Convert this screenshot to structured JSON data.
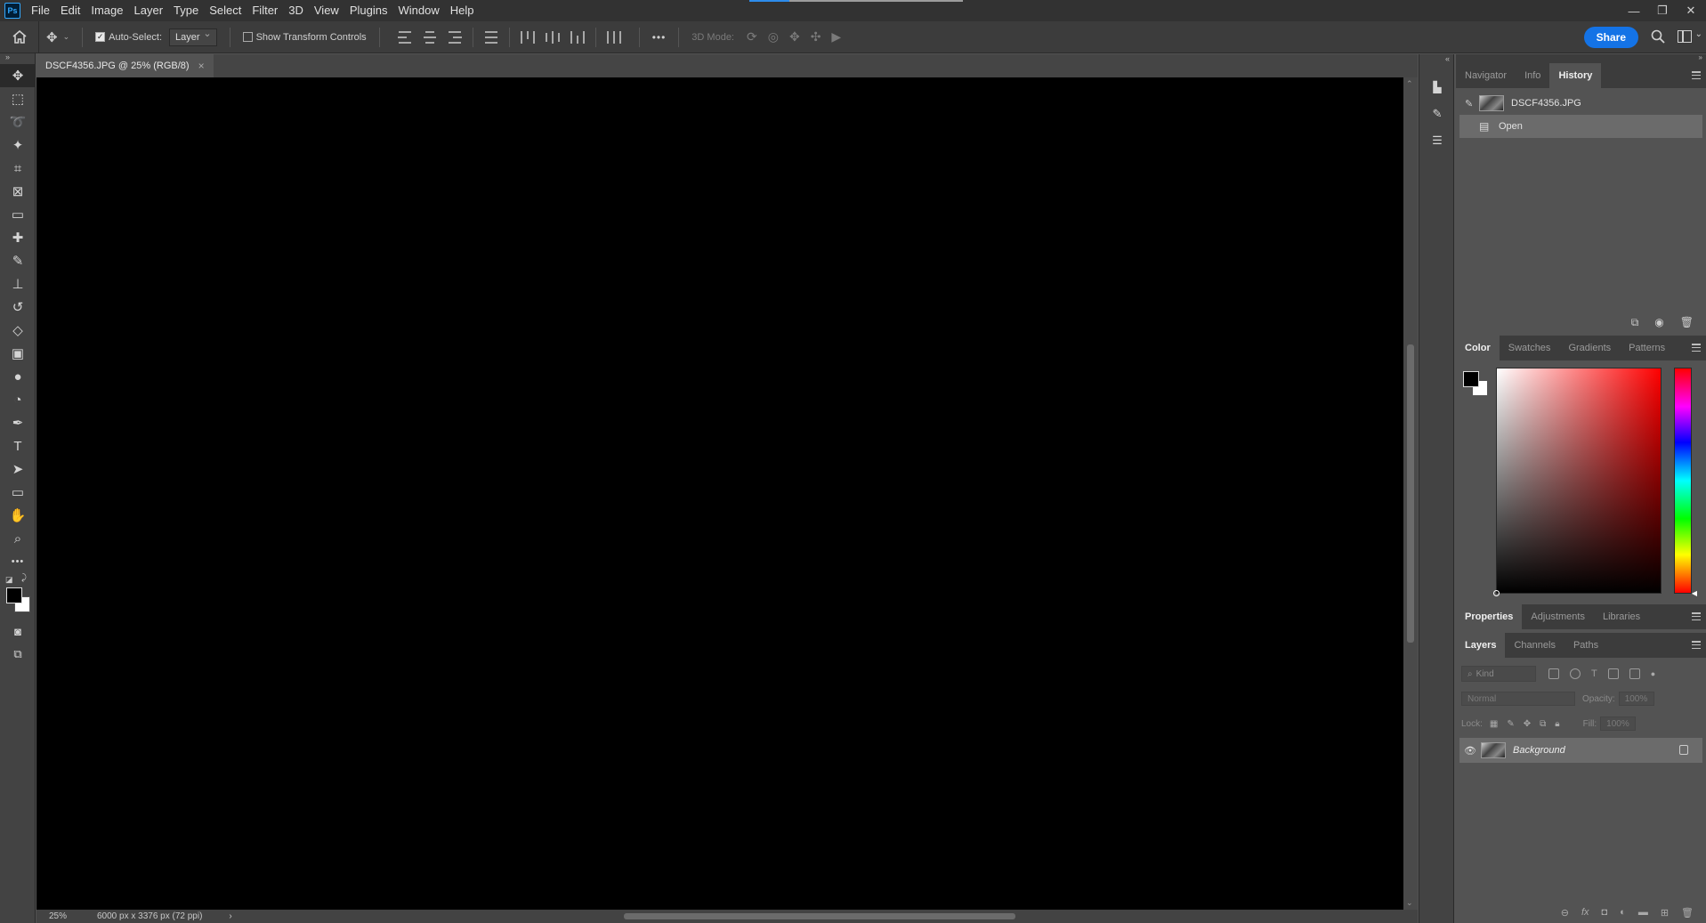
{
  "app": {
    "logo": "Ps"
  },
  "menu": [
    "File",
    "Edit",
    "Image",
    "Layer",
    "Type",
    "Select",
    "Filter",
    "3D",
    "View",
    "Plugins",
    "Window",
    "Help"
  ],
  "window_controls": {
    "minimize": "—",
    "restore": "❐",
    "close": "✕"
  },
  "options": {
    "auto_select_label": "Auto-Select:",
    "auto_select_checked": true,
    "auto_select_target": "Layer",
    "transform_controls_label": "Show Transform Controls",
    "more": "•••",
    "mode_3d_label": "3D Mode:",
    "share_label": "Share"
  },
  "tools": [
    {
      "name": "move-tool",
      "glyph": "✥"
    },
    {
      "name": "marquee-tool",
      "glyph": "⬚"
    },
    {
      "name": "lasso-tool",
      "glyph": "➰"
    },
    {
      "name": "magic-wand-tool",
      "glyph": "✦"
    },
    {
      "name": "crop-tool",
      "glyph": "⌗"
    },
    {
      "name": "frame-tool",
      "glyph": "⊠"
    },
    {
      "name": "ruler-tool",
      "glyph": "▭"
    },
    {
      "name": "healing-brush-tool",
      "glyph": "✚"
    },
    {
      "name": "brush-tool",
      "glyph": "✎"
    },
    {
      "name": "clone-stamp-tool",
      "glyph": "⊥"
    },
    {
      "name": "history-brush-tool",
      "glyph": "↺"
    },
    {
      "name": "eraser-tool",
      "glyph": "◇"
    },
    {
      "name": "gradient-tool",
      "glyph": "▣"
    },
    {
      "name": "blur-tool",
      "glyph": "●"
    },
    {
      "name": "dodge-tool",
      "glyph": "◔"
    },
    {
      "name": "pen-tool",
      "glyph": "✒"
    },
    {
      "name": "type-tool",
      "glyph": "T"
    },
    {
      "name": "path-selection-tool",
      "glyph": "➤"
    },
    {
      "name": "rectangle-tool",
      "glyph": "▭"
    },
    {
      "name": "hand-tool",
      "glyph": "✋"
    },
    {
      "name": "zoom-tool",
      "glyph": "⌕"
    },
    {
      "name": "more-tools",
      "glyph": "•••"
    }
  ],
  "document": {
    "tab_title": "DSCF4356.JPG @ 25% (RGB/8)",
    "close": "×",
    "zoom": "25%",
    "dimensions": "6000 px x 3376 px (72 ppi)",
    "status_arrow": "›"
  },
  "history_panel": {
    "tabs": [
      "Navigator",
      "Info",
      "History"
    ],
    "active_tab": "History",
    "snapshot_label": "DSCF4356.JPG",
    "items": [
      "Open"
    ]
  },
  "color_panel": {
    "tabs": [
      "Color",
      "Swatches",
      "Gradients",
      "Patterns"
    ],
    "active_tab": "Color",
    "foreground": "#000000",
    "background": "#ffffff"
  },
  "properties_panel": {
    "tabs": [
      "Properties",
      "Adjustments",
      "Libraries"
    ],
    "active_tab": "Properties"
  },
  "layers_panel": {
    "tabs": [
      "Layers",
      "Channels",
      "Paths"
    ],
    "active_tab": "Layers",
    "kind_placeholder": "Kind",
    "blend_mode": "Normal",
    "opacity_label": "Opacity:",
    "opacity_value": "100%",
    "lock_label": "Lock:",
    "fill_label": "Fill:",
    "fill_value": "100%",
    "layers": [
      {
        "name": "Background",
        "visible": true,
        "locked": true
      }
    ]
  }
}
